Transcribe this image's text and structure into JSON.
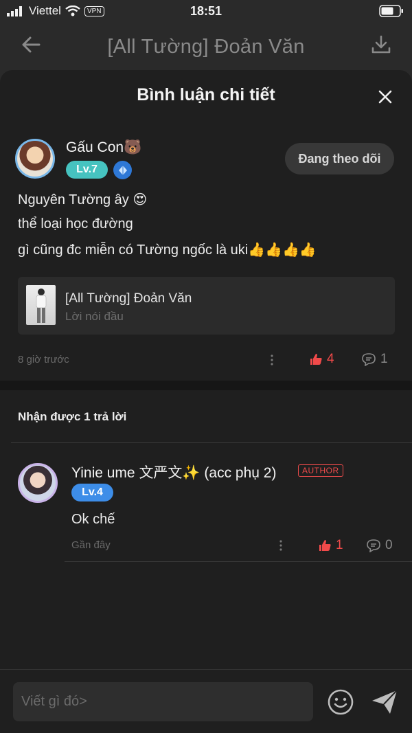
{
  "status_bar": {
    "carrier": "Viettel",
    "vpn": "VPN",
    "time": "18:51"
  },
  "nav": {
    "title": "[All Tường] Đoản Văn"
  },
  "sheet": {
    "title": "Bình luận chi tiết"
  },
  "main_comment": {
    "username": "Gấu Con🐻",
    "level": "Lv.7",
    "follow_label": "Đang theo dõi",
    "lines": [
      "Nguyên Tường ây 😍",
      "thể loại học đường",
      "gì cũng đc miễn có Tường ngốc là uki👍👍👍👍"
    ],
    "story": {
      "title": "[All Tường] Đoản Văn",
      "chapter": "Lời nói đầu"
    },
    "time": "8 giờ trước",
    "likes": "4",
    "replies": "1"
  },
  "replies_header": "Nhận được 1 trả lời",
  "reply": {
    "username": "Yinie ume 文严文✨ (acc phụ 2)",
    "author_badge": "AUTHOR",
    "level": "Lv.4",
    "text": "Ok chế",
    "time": "Gần đây",
    "likes": "1",
    "replies": "0"
  },
  "input": {
    "placeholder": "Viết gì đó>"
  },
  "colors": {
    "like_red": "#f14a4a",
    "level7_teal": "#46c3c0",
    "level4_blue": "#3d8de8",
    "sheet_bg": "#1f1f1f"
  },
  "icons": [
    "signal-icon",
    "wifi-icon",
    "battery-icon",
    "back-arrow-icon",
    "download-icon",
    "close-icon",
    "diamond-icon",
    "more-icon",
    "like-icon",
    "comment-icon",
    "emoji-icon",
    "send-icon"
  ]
}
